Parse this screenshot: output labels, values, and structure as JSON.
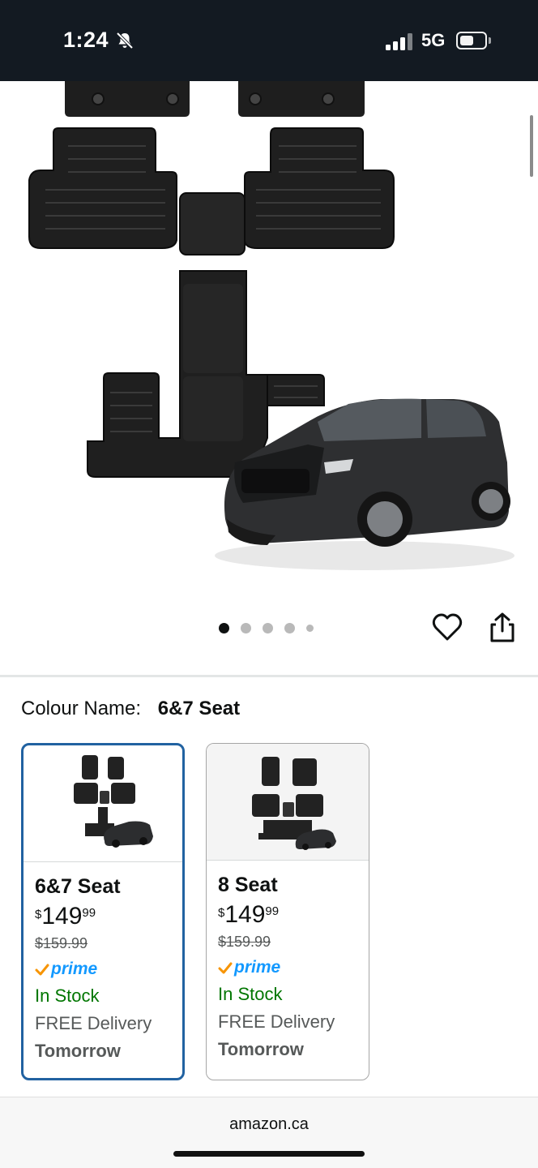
{
  "status_bar": {
    "time": "1:24",
    "network": "5G",
    "icons": [
      "bell-slash-icon",
      "signal-icon",
      "battery-icon"
    ]
  },
  "product": {
    "image_alt_icons": [
      "floor-mat-set-image",
      "suv-car-image"
    ],
    "carousel": {
      "count": 5,
      "active_index": 0
    }
  },
  "actions": {
    "wishlist_icon": "heart-icon",
    "share_icon": "share-icon"
  },
  "colour": {
    "label": "Colour Name:",
    "value": "6&7 Seat"
  },
  "variants": [
    {
      "name": "6&7 Seat",
      "currency": "$",
      "price_whole": "149",
      "price_fraction": "99",
      "list_price": "$159.99",
      "prime": "prime",
      "stock": "In Stock",
      "delivery": "FREE Delivery",
      "delivery_day": "Tomorrow",
      "selected": true
    },
    {
      "name": "8 Seat",
      "currency": "$",
      "price_whole": "149",
      "price_fraction": "99",
      "list_price": "$159.99",
      "prime": "prime",
      "stock": "In Stock",
      "delivery": "FREE Delivery",
      "delivery_day": "Tomorrow",
      "selected": false
    }
  ],
  "browser": {
    "domain": "amazon.ca"
  },
  "colors": {
    "accent_selected": "#2162a1",
    "in_stock": "#007600",
    "prime_blue": "#1399ff",
    "prime_check": "#f79400"
  }
}
